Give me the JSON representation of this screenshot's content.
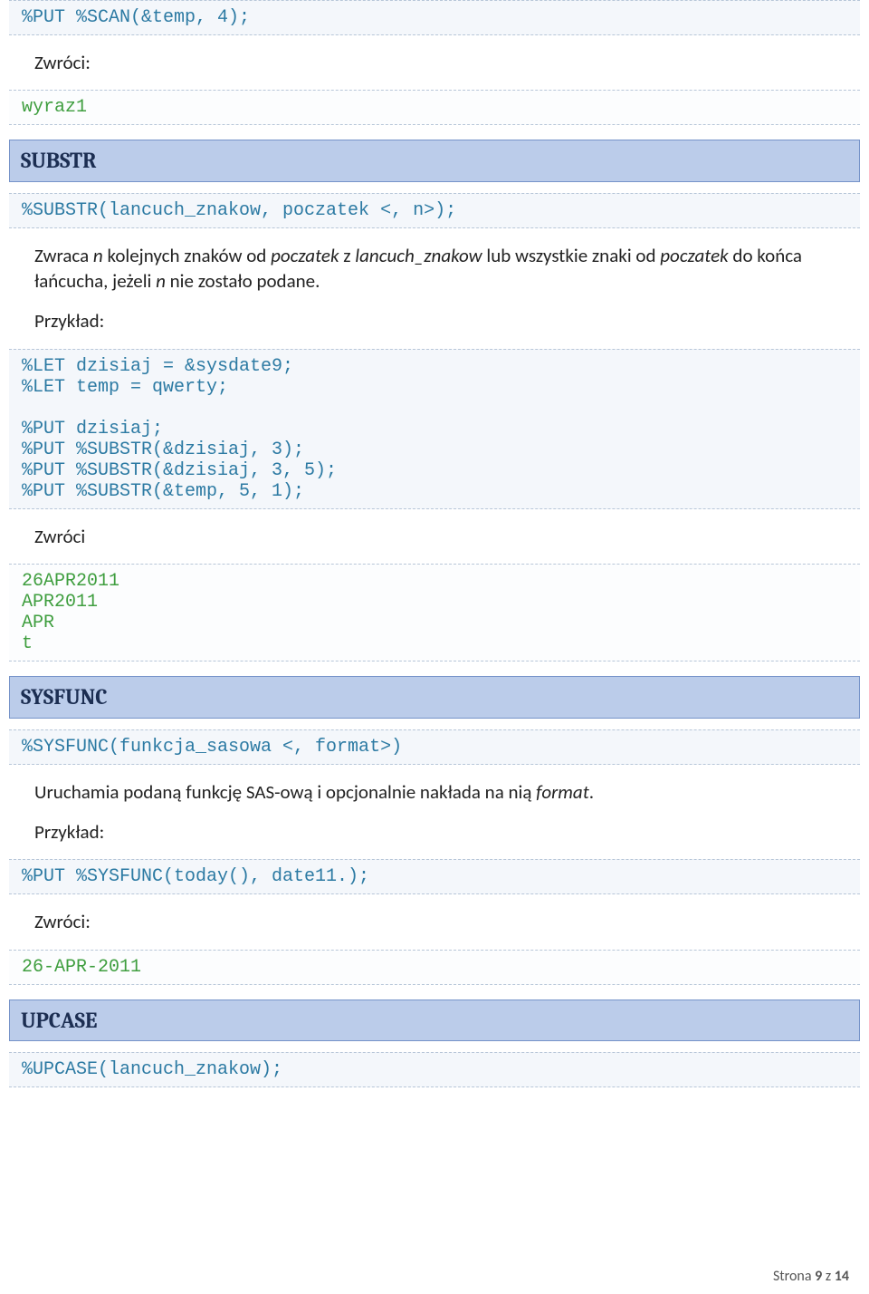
{
  "blocks": {
    "code1": "%PUT %SCAN(&temp, 4);",
    "text1_label": "Zwróci:",
    "out1": "wyraz1",
    "heading_substr": "SUBSTR",
    "code_substr_sig": "%SUBSTR(lancuch_znakow, poczatek <, n>);",
    "text_substr_desc_pre": "Zwraca ",
    "text_substr_desc_n": "n",
    "text_substr_desc_mid1": " kolejnych znaków od ",
    "text_substr_desc_poczatek": "poczatek",
    "text_substr_desc_mid2": " z ",
    "text_substr_desc_lz": "lancuch_znakow",
    "text_substr_desc_mid3": " lub wszystkie znaki od ",
    "text_substr_desc_poczatek2": "poczatek",
    "text_substr_desc_mid4": " do końca łańcucha, jeżeli ",
    "text_substr_desc_n2": "n",
    "text_substr_desc_end": " nie zostało podane.",
    "text_example": "Przykład:",
    "code_substr_ex": "%LET dzisiaj = &sysdate9;\n%LET temp = qwerty;\n\n%PUT dzisiaj;\n%PUT %SUBSTR(&dzisiaj, 3);\n%PUT %SUBSTR(&dzisiaj, 3, 5);\n%PUT %SUBSTR(&temp, 5, 1);",
    "text_zwroci": "Zwróci",
    "out_substr": "26APR2011\nAPR2011\nAPR\nt",
    "heading_sysfunc": "SYSFUNC",
    "code_sysfunc_sig": "%SYSFUNC(funkcja_sasowa <, format>)",
    "text_sysfunc_desc_pre": "Uruchamia podaną funkcję SAS-ową i opcjonalnie nakłada na nią ",
    "text_sysfunc_desc_format": "format",
    "text_sysfunc_desc_end": ".",
    "code_sysfunc_ex": "%PUT %SYSFUNC(today(), date11.);",
    "out_sysfunc": "26-APR-2011",
    "heading_upcase": "UPCASE",
    "code_upcase_sig": "%UPCASE(lancuch_znakow);"
  },
  "footer": {
    "prefix": "Strona ",
    "page_current": "9",
    "mid": " z ",
    "page_total": "14"
  }
}
